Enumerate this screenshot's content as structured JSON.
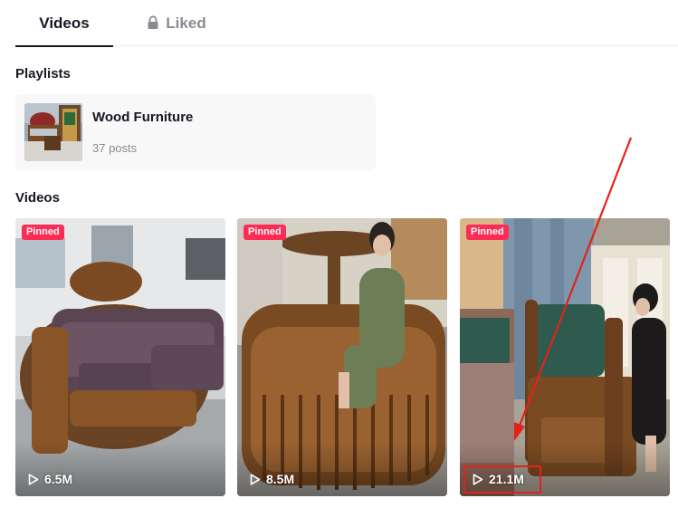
{
  "tabs": {
    "videos_label": "Videos",
    "liked_label": "Liked"
  },
  "playlists": {
    "title": "Playlists",
    "items": [
      {
        "name": "Wood Furniture",
        "count": "37 posts"
      }
    ]
  },
  "videos": {
    "title": "Videos",
    "items": [
      {
        "badge": "Pinned",
        "views": "6.5M"
      },
      {
        "badge": "Pinned",
        "views": "8.5M"
      },
      {
        "badge": "Pinned",
        "views": "21.1M"
      }
    ]
  },
  "colors": {
    "accent": "#fe2c55",
    "text": "#161823",
    "muted": "#8a8b91",
    "annotation": "#e2231a"
  },
  "icons": {
    "liked_tab": "lock-icon",
    "views": "play-icon"
  }
}
